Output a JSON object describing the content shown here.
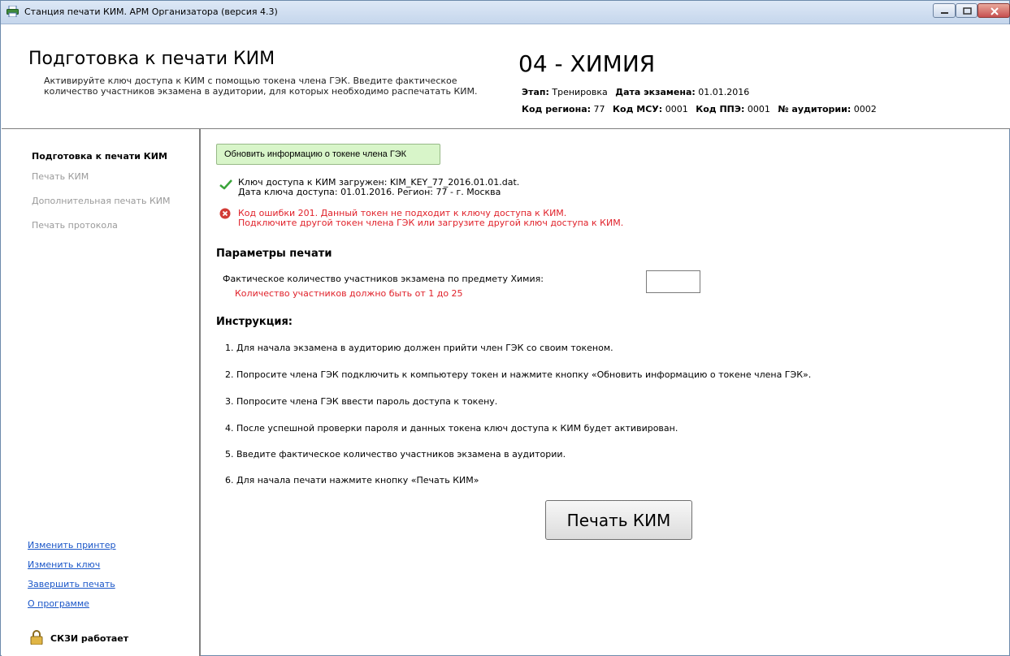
{
  "window": {
    "title": "Станция печати КИМ. АРМ Организатора (версия 4.3)"
  },
  "header": {
    "title": "Подготовка к печати КИМ",
    "description": "Активируйте ключ доступа к КИМ с помощью токена члена ГЭК. Введите фактическое количество участников экзамена в аудитории, для которых необходимо распечатать КИМ.",
    "subject": "04 - ХИМИЯ",
    "stage_label": "Этап:",
    "stage_value": "Тренировка",
    "exam_date_label": "Дата экзамена:",
    "exam_date_value": "01.01.2016",
    "region_label": "Код региона:",
    "region_value": "77",
    "msu_label": "Код МСУ:",
    "msu_value": "0001",
    "ppe_label": "Код ППЭ:",
    "ppe_value": "0001",
    "room_label": "№ аудитории:",
    "room_value": "0002"
  },
  "sidebar": {
    "items": [
      {
        "label": "Подготовка к печати КИМ"
      },
      {
        "label": "Печать КИМ"
      },
      {
        "label": "Дополнительная печать КИМ"
      },
      {
        "label": "Печать протокола"
      }
    ],
    "links": [
      {
        "label": "Изменить принтер"
      },
      {
        "label": "Изменить ключ"
      },
      {
        "label": "Завершить печать"
      },
      {
        "label": "О программе"
      }
    ],
    "status": "СКЗИ работает"
  },
  "main": {
    "refresh_button": "Обновить информацию о токене члена ГЭК",
    "success_line1": "Ключ доступа к КИМ загружен: KIM_KEY_77_2016.01.01.dat.",
    "success_line2": "Дата ключа доступа: 01.01.2016. Регион: 77 - г. Москва",
    "error_line1": "Код ошибки 201. Данный токен не подходит к ключу доступа к КИМ.",
    "error_line2": "Подключите другой токен члена ГЭК или загрузите другой ключ доступа к КИМ.",
    "params_title": "Параметры печати",
    "count_label": "Фактическое количество участников экзамена по предмету Химия:",
    "count_value": "",
    "count_error": "Количество участников должно быть от 1 до 25",
    "instructions_title": "Инструкция:",
    "steps": [
      "1. Для начала экзамена в аудиторию должен прийти член ГЭК со своим токеном.",
      "2. Попросите члена ГЭК подключить к компьютеру токен и нажмите кнопку «Обновить информацию о токене члена ГЭК».",
      "3. Попросите члена ГЭК ввести пароль доступа к токену.",
      "4. После успешной проверки пароля и данных токена ключ доступа к КИМ будет активирован.",
      "5. Введите фактическое количество участников экзамена в аудитории.",
      "6. Для начала печати нажмите кнопку «Печать КИМ»"
    ],
    "print_button": "Печать КИМ"
  },
  "colors": {
    "error": "#e0212a",
    "link": "#1a56c8",
    "success": "#3aa43a",
    "refresh_bg": "#d8f5c9",
    "disabled": "#9a9a9a"
  }
}
